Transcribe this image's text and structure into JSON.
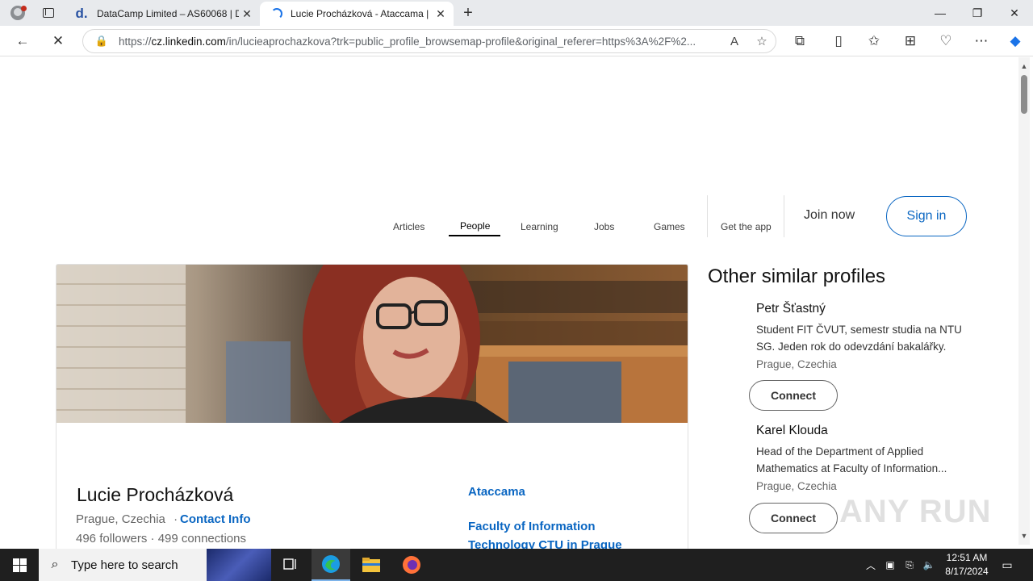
{
  "browser": {
    "tabs": [
      {
        "title": "DataCamp Limited – AS60068 | D",
        "favicon": "d."
      },
      {
        "title": "Lucie Procházková - Ataccama | ",
        "loading": true
      }
    ],
    "address": {
      "prefix": "https://",
      "domain": "cz.linkedin.com",
      "path": "/in/lucieaprochazkova?trk=public_profile_browsemap-profile&original_referer=https%3A%2F%2..."
    }
  },
  "linkedin_nav": {
    "items": [
      "Articles",
      "People",
      "Learning",
      "Jobs",
      "Games",
      "Get the app"
    ],
    "active": "People",
    "join": "Join now",
    "signin": "Sign in"
  },
  "profile": {
    "name": "Lucie Procházková",
    "location": "Prague, Czechia",
    "separator": "·",
    "contact": "Contact Info",
    "stats": "496 followers · 499 connections",
    "company": "Ataccama",
    "school": "Faculty of Information Technology CTU in Prague"
  },
  "similar": {
    "title": "Other similar profiles",
    "people": [
      {
        "name": "Petr Šťastný",
        "desc": "Student FIT ČVUT, semestr studia na NTU SG. Jeden rok do odevzdání bakalářky.",
        "loc": "Prague, Czechia",
        "btn": "Connect"
      },
      {
        "name": "Karel Klouda",
        "desc": "Head of the Department of Applied Mathematics at Faculty of Information...",
        "loc": "Prague, Czechia",
        "btn": "Connect"
      }
    ]
  },
  "watermark": "ANY RUN",
  "taskbar": {
    "search_placeholder": "Type here to search",
    "time": "12:51 AM",
    "date": "8/17/2024"
  }
}
